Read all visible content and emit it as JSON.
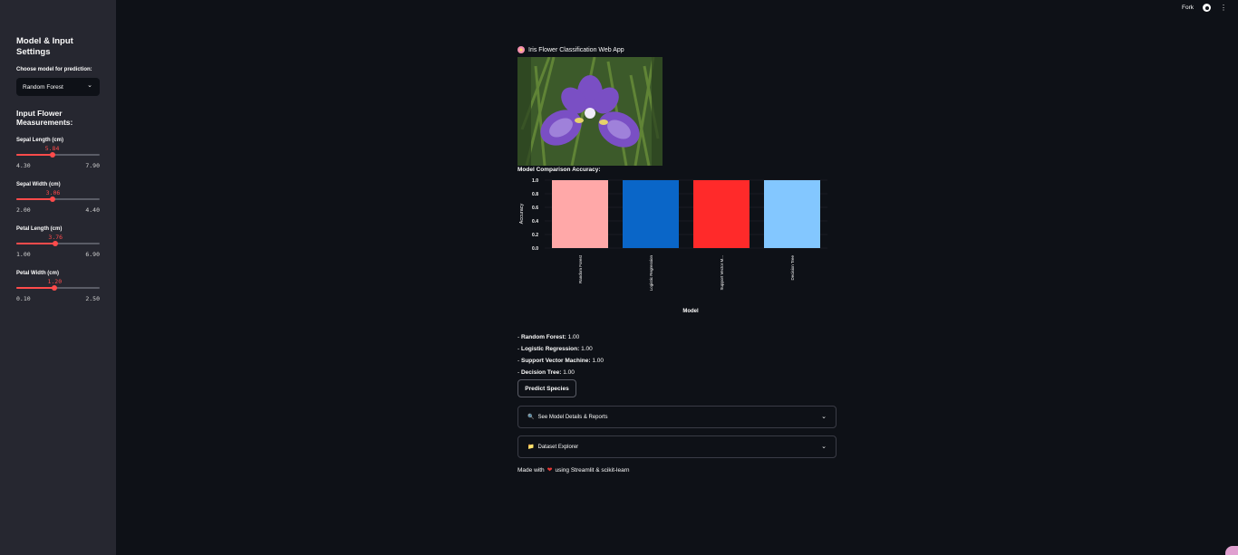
{
  "topbar": {
    "fork_label": "Fork"
  },
  "sidebar": {
    "title": "Model & Input Settings",
    "model_label": "Choose model for prediction:",
    "model_selected": "Random Forest",
    "measurements_title": "Input Flower Measurements:",
    "sliders": [
      {
        "label": "Sepal Length (cm)",
        "value": "5.84",
        "min": "4.30",
        "max": "7.90",
        "fraction": 0.428
      },
      {
        "label": "Sepal Width (cm)",
        "value": "3.06",
        "min": "2.00",
        "max": "4.40",
        "fraction": 0.442
      },
      {
        "label": "Petal Length (cm)",
        "value": "3.76",
        "min": "1.00",
        "max": "6.90",
        "fraction": 0.468
      },
      {
        "label": "Petal Width (cm)",
        "value": "1.20",
        "min": "0.10",
        "max": "2.50",
        "fraction": 0.458
      }
    ]
  },
  "main": {
    "app_title": "Iris Flower Classification Web App",
    "chart_title": "Model Comparison Accuracy:",
    "accuracies": [
      {
        "name": "Random Forest:",
        "value": "1.00"
      },
      {
        "name": "Logistic Regression:",
        "value": "1.00"
      },
      {
        "name": "Support Vector Machine:",
        "value": "1.00"
      },
      {
        "name": "Decision Tree:",
        "value": "1.00"
      }
    ],
    "predict_button": "Predict Species",
    "expanders": [
      {
        "label": "See Model Details & Reports",
        "icon": "🔍"
      },
      {
        "label": "Dataset Explorer",
        "icon": "📁"
      }
    ],
    "footer_prefix": "Made with",
    "footer_suffix": "using Streamlit & scikit-learn"
  },
  "chart_data": {
    "type": "bar",
    "categories": [
      "Random Forest",
      "Logistic Regression",
      "Support Vector M...",
      "Decision Tree"
    ],
    "values": [
      1.0,
      1.0,
      1.0,
      1.0
    ],
    "colors": [
      "#ffa8a8",
      "#0a66c8",
      "#ff2a2a",
      "#83c7ff"
    ],
    "xlabel": "Model",
    "ylabel": "Accuracy",
    "ylim": [
      0,
      1.0
    ],
    "yticks": [
      "0.0",
      "0.2",
      "0.4",
      "0.6",
      "0.8",
      "1.0"
    ]
  }
}
